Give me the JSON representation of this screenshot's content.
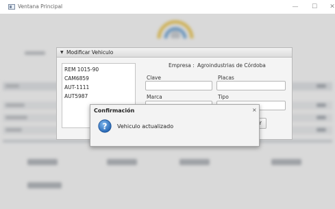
{
  "window": {
    "title": "Ventana Principal",
    "minimize": "—",
    "maximize": "☐",
    "close": "✕"
  },
  "panel": {
    "title": "Modificar Vehiculo",
    "vehicles": [
      "REM 1015-90",
      "CAM6859",
      "AUT-1111",
      "AUT5987"
    ],
    "empresa_label": "Empresa :",
    "empresa_value": "Agroindustrias de Córdoba",
    "labels": {
      "clave": "Clave",
      "placas": "Placas",
      "marca": "Marca",
      "tipo": "Tipo"
    },
    "delete_button_partial": "rrar"
  },
  "dialog": {
    "title": "Confirmación",
    "close": "×",
    "message": "Vehiculo actualizado",
    "icon": "question-icon"
  }
}
